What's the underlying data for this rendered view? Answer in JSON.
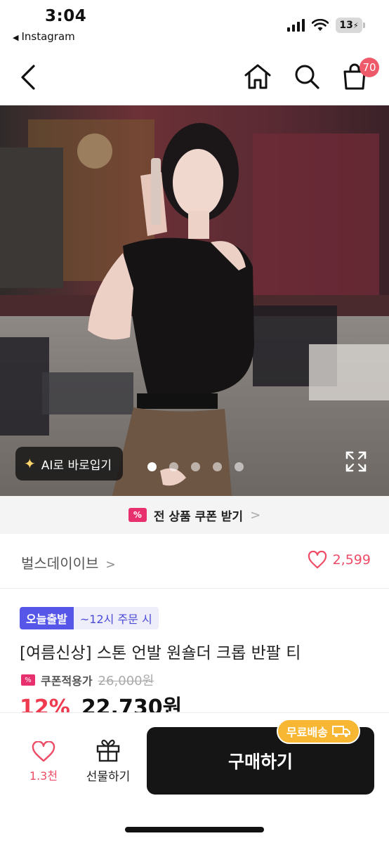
{
  "status_bar": {
    "time": "3:04",
    "back_app": "Instagram",
    "battery": "13"
  },
  "nav": {
    "cart_count": "70"
  },
  "hero": {
    "ai_fit_label": "AI로 바로입기",
    "carousel_total": 5,
    "carousel_active": 1
  },
  "coupon_strip": {
    "tag_icon": "%",
    "label": "전 상품 쿠폰 받기",
    "chevron": ">"
  },
  "brand": {
    "name": "벌스데이이브",
    "chevron": ">",
    "likes": "2,599"
  },
  "product": {
    "badge_today": "오늘출발",
    "badge_cutoff": "~12시 주문 시",
    "title": "[여름신상] 스톤 언발 원숄더 크롭 반팔 티",
    "coupon_tag": "%",
    "coupon_label": "쿠폰적용가",
    "original_price": "26,000원",
    "discount": "12%",
    "price": "22,730원"
  },
  "bottom_bar": {
    "wish_count": "1.3천",
    "gift_label": "선물하기",
    "buy_label": "구매하기",
    "free_shipping": "무료배송"
  },
  "colors": {
    "accent_pink": "#ee4c66",
    "coupon_magenta": "#e8306f",
    "badge_blue": "#5656e8",
    "free_ship_yellow": "#f7b733",
    "buy_button": "#151515"
  }
}
